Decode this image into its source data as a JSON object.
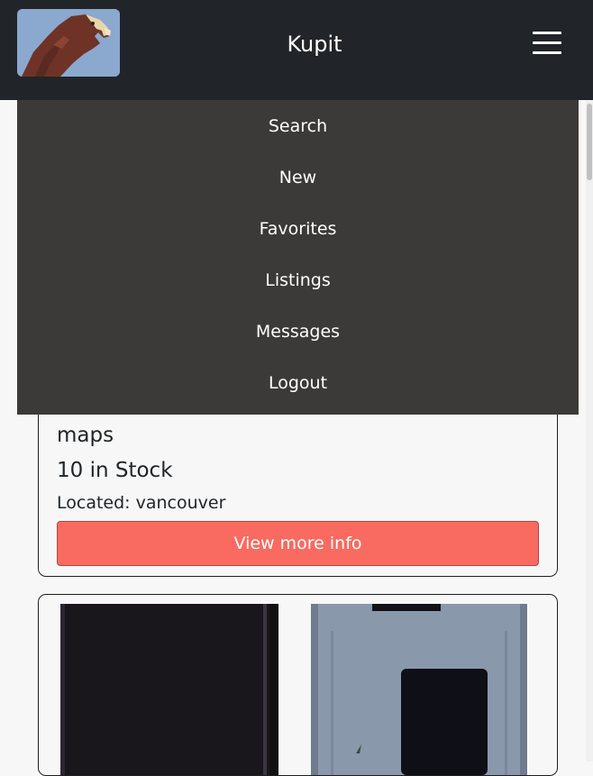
{
  "navbar": {
    "brand": "Kupit",
    "logo_icon": "eagle-logo-icon",
    "menu_icon": "hamburger-menu-icon",
    "background": "#212529"
  },
  "menu": {
    "background": "#3b3a38",
    "items": [
      {
        "label": "Search"
      },
      {
        "label": "New"
      },
      {
        "label": "Favorites"
      },
      {
        "label": "Listings"
      },
      {
        "label": "Messages"
      },
      {
        "label": "Logout"
      }
    ]
  },
  "listing": {
    "title": "maps",
    "stock": "10 in Stock",
    "location": "Located: vancouver",
    "button": "View more info",
    "button_color": "#f96b60"
  }
}
